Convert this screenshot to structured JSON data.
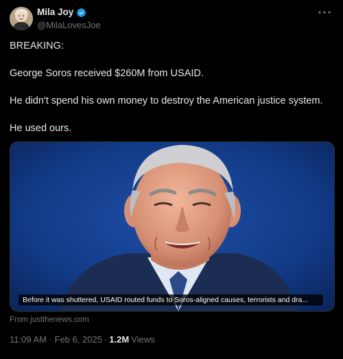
{
  "author": {
    "name": "Mila Joy",
    "handle": "@MilaLovesJoe",
    "verified": true
  },
  "tweet": {
    "paragraphs": [
      "BREAKING:",
      "George Soros received $260M from USAID.",
      "He didn't spend his own money to destroy the American justice system.",
      "He used ours."
    ]
  },
  "media": {
    "caption": "Before it was shuttered, USAID routed funds to Soros-aligned causes, terrorists and dra..."
  },
  "card_source": "From justthenews.com",
  "meta": {
    "timestamp": "11:09 AM · Feb 6, 2025",
    "separator": "·",
    "views_count": "1.2M",
    "views_label": "Views"
  },
  "colors": {
    "background": "#000000",
    "text": "#e7e9ea",
    "secondary_text": "#71767b",
    "verified_badge": "#1d9bf0"
  },
  "icons": [
    "verified-badge-icon",
    "more-options-icon"
  ]
}
